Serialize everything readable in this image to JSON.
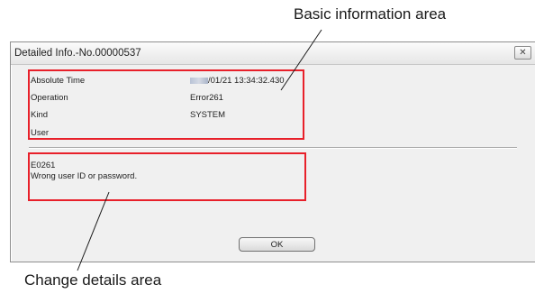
{
  "callouts": {
    "basic_info": "Basic information area",
    "change_details": "Change details area"
  },
  "window": {
    "title": "Detailed Info.-No.00000537",
    "close_icon": "close-icon"
  },
  "basic_info": {
    "rows": [
      {
        "label": "Absolute Time",
        "value": "/01/21 13:34:32.430"
      },
      {
        "label": "Operation",
        "value": "Error261"
      },
      {
        "label": "Kind",
        "value": "SYSTEM"
      },
      {
        "label": "User",
        "value": ""
      }
    ]
  },
  "details": {
    "code": "E0261",
    "message": "Wrong user ID or password."
  },
  "buttons": {
    "ok_label": "OK"
  },
  "colors": {
    "highlight": "#e8202a",
    "window_bg": "#f0f0f0"
  }
}
